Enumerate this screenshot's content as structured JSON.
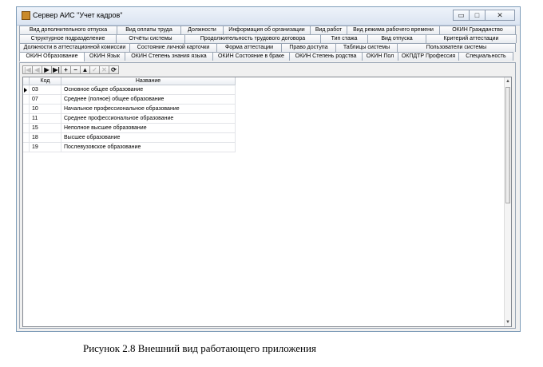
{
  "window": {
    "title": "Сервер АИС \"Учет кадров\""
  },
  "window_buttons": {
    "minimize": "▭",
    "maximize": "□",
    "close": "✕"
  },
  "tabs": {
    "row1": [
      "Вид дополнительного отпуска",
      "Вид оплаты труда",
      "Должности",
      "Информация об организации",
      "Вид работ",
      "Вид режима рабочего времени",
      "ОКИН Гражданство"
    ],
    "row2": [
      "Структурное подразделение",
      "Отчёты системы",
      "Продолжительность трудового договора",
      "Тип стажа",
      "Вид отпуска",
      "Критерий аттестации"
    ],
    "row3": [
      "Должности в аттестационной комиссии",
      "Состояние личной карточки",
      "Форма аттестации",
      "Право доступа",
      "Таблицы системы",
      "Пользователи системы"
    ],
    "row4": [
      "ОКИН Образование",
      "ОКИН Язык",
      "ОКИН Степень знания языка",
      "ОКИН Состояние в браке",
      "ОКИН Степень родства",
      "ОКИН Пол",
      "ОКПДТР Профессия",
      "Специальность"
    ],
    "active": "ОКИН Образование"
  },
  "navigator": {
    "first": "|◀",
    "prior": "◀",
    "next": "▶",
    "last": "▶|",
    "insert": "+",
    "delete": "−",
    "edit": "▲",
    "post": "✓",
    "cancel": "✕",
    "refresh": "⟳"
  },
  "grid": {
    "columns": [
      "Код",
      "Название"
    ],
    "rows": [
      [
        "03",
        "Основное общее образование"
      ],
      [
        "07",
        "Среднее (полное) общее образование"
      ],
      [
        "10",
        "Начальное профессиональное образование"
      ],
      [
        "11",
        "Среднее профессиональное образование"
      ],
      [
        "15",
        "Неполное высшее образование"
      ],
      [
        "18",
        "Высшее образование"
      ],
      [
        "19",
        "Послевузовское образование"
      ]
    ]
  },
  "scroll": {
    "up": "▲",
    "down": "▼"
  },
  "caption": "Рисунок 2.8 Внешний вид работающего приложения"
}
